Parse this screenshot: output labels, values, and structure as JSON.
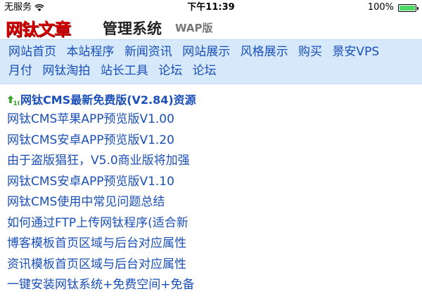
{
  "status_bar": {
    "carrier": "无服务",
    "time": "下午11:39",
    "battery": "100%"
  },
  "header": {
    "logo_main": "网钛文章",
    "logo_sub": "管理系统",
    "logo_wap": "WAP版"
  },
  "nav": {
    "items": [
      "网站首页",
      "本站程序",
      "新闻资讯",
      "网站展示",
      "风格展示",
      "购买",
      "景安VPS",
      "月付",
      "网钛淘拍",
      "站长工具",
      "论坛",
      "论坛"
    ]
  },
  "content": {
    "featured": "网钛CMS最新免费版(V2.84)资源",
    "articles": [
      "网钛CMS苹果APP预览版V1.00",
      "网钛CMS安卓APP预览版V1.20",
      "由于盗版猖狂，V5.0商业版将加强",
      "网钛CMS安卓APP预览版V1.10",
      "网钛CMS使用中常见问题总结",
      "如何通过FTP上传网钛程序(适合新",
      "博客模板首页区域与后台对应属性",
      "资讯模板首页区域与后台对应属性",
      "一键安装网钛系统+免费空间+免备"
    ]
  },
  "colors": {
    "link": "#1a4fb8",
    "nav_background": "#d6e9fb",
    "logo_red": "#d40000",
    "battery_green": "#4cd964"
  }
}
